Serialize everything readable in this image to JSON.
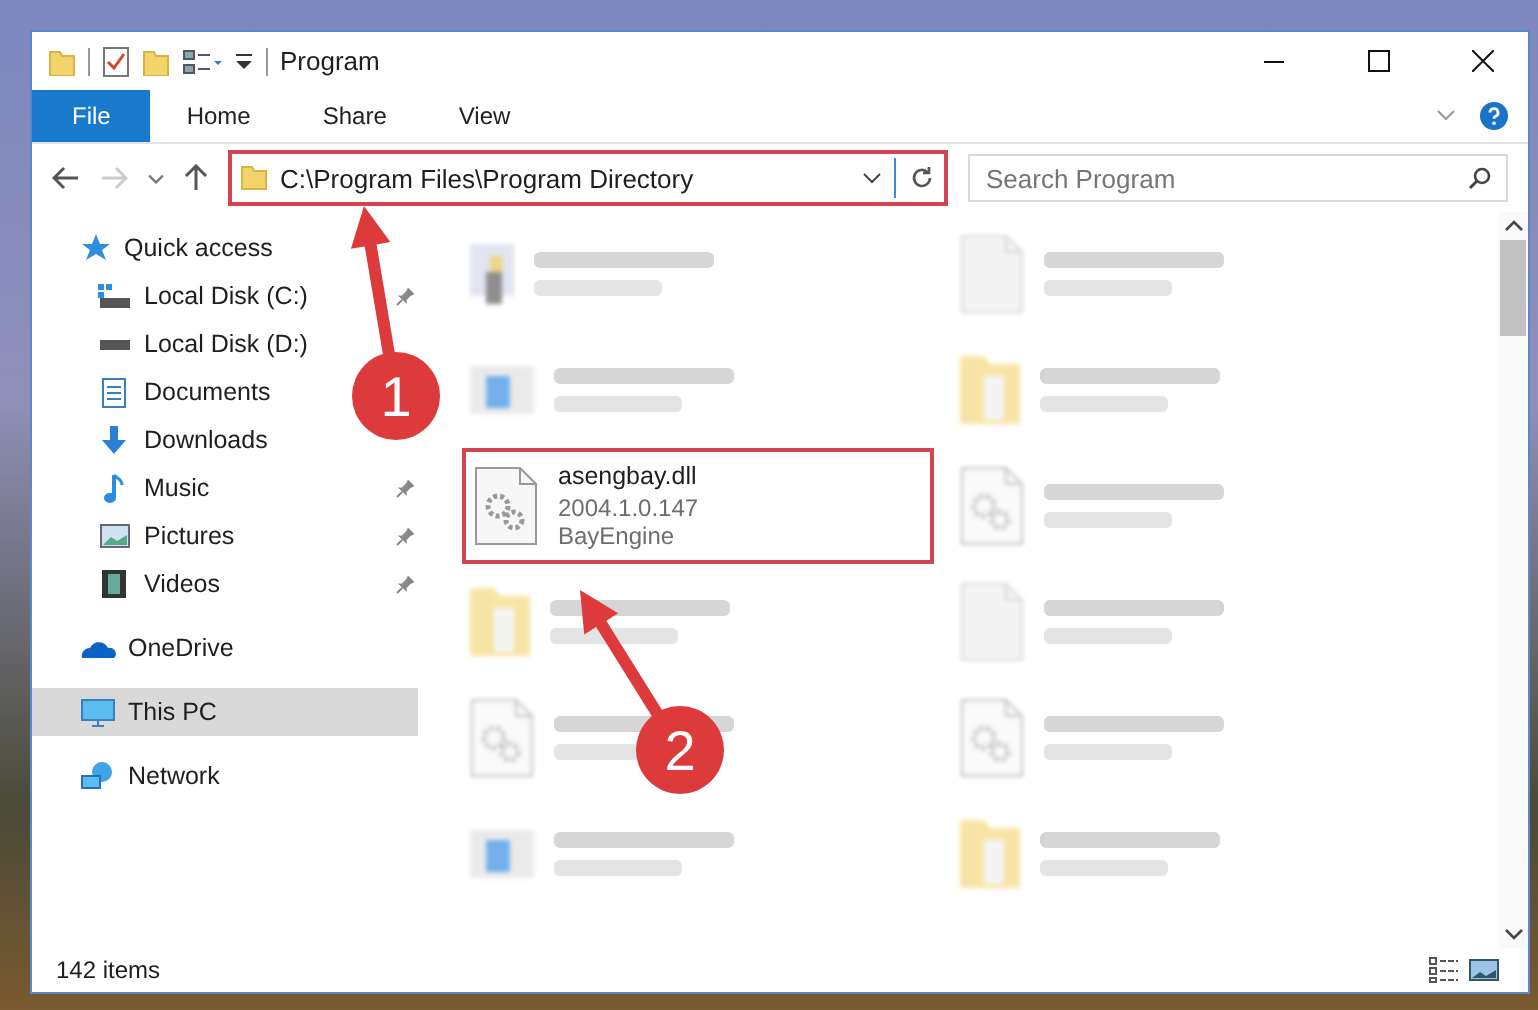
{
  "window": {
    "title": "Program"
  },
  "ribbon_tabs": [
    {
      "label": "File",
      "selected": true
    },
    {
      "label": "Home",
      "selected": false
    },
    {
      "label": "Share",
      "selected": false
    },
    {
      "label": "View",
      "selected": false
    }
  ],
  "address": {
    "value": "C:\\Program Files\\Program Directory",
    "highlighted": true
  },
  "search": {
    "placeholder": "Search Program"
  },
  "navigation": [
    {
      "label": "Quick access",
      "kind": "star",
      "selected": false,
      "children": [
        {
          "label": "Local Disk (C:)",
          "kind": "disk-c",
          "pinned": true
        },
        {
          "label": "Local Disk (D:)",
          "kind": "disk",
          "pinned": false
        },
        {
          "label": "Documents",
          "kind": "documents",
          "pinned": false
        },
        {
          "label": "Downloads",
          "kind": "downloads",
          "pinned": false
        },
        {
          "label": "Music",
          "kind": "music",
          "pinned": true
        },
        {
          "label": "Pictures",
          "kind": "pictures",
          "pinned": true
        },
        {
          "label": "Videos",
          "kind": "videos",
          "pinned": true
        }
      ]
    },
    {
      "label": "OneDrive",
      "kind": "cloud",
      "selected": false
    },
    {
      "label": "This PC",
      "kind": "pc",
      "selected": true
    },
    {
      "label": "Network",
      "kind": "network",
      "selected": false
    }
  ],
  "files": [
    {
      "kind": "exe",
      "blurred": true,
      "highlighted": false
    },
    {
      "kind": "file",
      "blurred": true,
      "highlighted": false
    },
    {
      "kind": "app",
      "blurred": true,
      "highlighted": false
    },
    {
      "kind": "folder",
      "blurred": true,
      "highlighted": false
    },
    {
      "name": "asengbay.dll",
      "details": [
        "2004.1.0.147",
        "BayEngine"
      ],
      "kind": "dll",
      "blurred": false,
      "highlighted": true
    },
    {
      "kind": "dll",
      "blurred": true,
      "highlighted": false
    },
    {
      "kind": "folder",
      "blurred": true,
      "highlighted": false
    },
    {
      "kind": "file",
      "blurred": true,
      "highlighted": false
    },
    {
      "kind": "dll",
      "blurred": true,
      "highlighted": false
    },
    {
      "kind": "dll",
      "blurred": true,
      "highlighted": false
    },
    {
      "kind": "app",
      "blurred": true,
      "highlighted": false
    },
    {
      "kind": "folder",
      "blurred": true,
      "highlighted": false
    }
  ],
  "status_bar": {
    "item_count": "142 items"
  },
  "annotations": [
    {
      "label": "1"
    },
    {
      "label": "2"
    }
  ]
}
